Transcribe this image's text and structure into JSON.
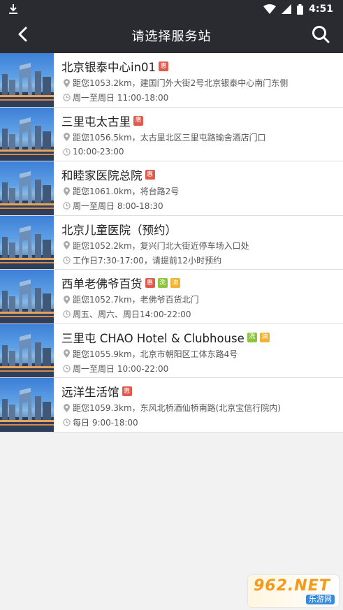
{
  "status_bar": {
    "time": "4:51"
  },
  "header": {
    "title": "请选择服务站"
  },
  "tag_colors": {
    "惠": "#e05a4e",
    "洗": "#8cc63f",
    "油": "#f2b234"
  },
  "stations": [
    {
      "name": "北京银泰中心in01",
      "tags": [
        "惠"
      ],
      "distance": "距您1053.2km，建国门外大街2号北京银泰中心南门东侧",
      "hours": "周一至周日 11:00-18:00"
    },
    {
      "name": "三里屯太古里",
      "tags": [
        "惠"
      ],
      "distance": "距您1056.5km，太古里北区三里屯路瑜舍酒店门口",
      "hours": "10:00-23:00"
    },
    {
      "name": "和睦家医院总院",
      "tags": [
        "惠"
      ],
      "distance": "距您1061.0km，将台路2号",
      "hours": "周一至周日 8:00-18:30"
    },
    {
      "name": "北京儿童医院（预约）",
      "tags": [],
      "distance": "距您1052.2km，复兴门北大街近停车场入口处",
      "hours": "工作日7:30-17:00，请提前12小时预约"
    },
    {
      "name": "西单老佛爷百货",
      "tags": [
        "惠",
        "洗",
        "油"
      ],
      "distance": "距您1052.7km，老佛爷百货北门",
      "hours": "周五、周六、周日14:00-22:00"
    },
    {
      "name": "三里屯 CHAO Hotel & Clubhouse",
      "tags": [
        "洗",
        "油"
      ],
      "distance": "距您1055.9km，北京市朝阳区工体东路4号",
      "hours": "周一至周日 10:00-22:00"
    },
    {
      "name": "远洋生活馆",
      "tags": [
        "惠"
      ],
      "distance": "距您1059.3km，东风北桥酒仙桥南路(北京宝信行院内)",
      "hours": "每日 9:00-18:00"
    }
  ],
  "watermark": {
    "main": "962.NET",
    "sub": "乐游网"
  }
}
